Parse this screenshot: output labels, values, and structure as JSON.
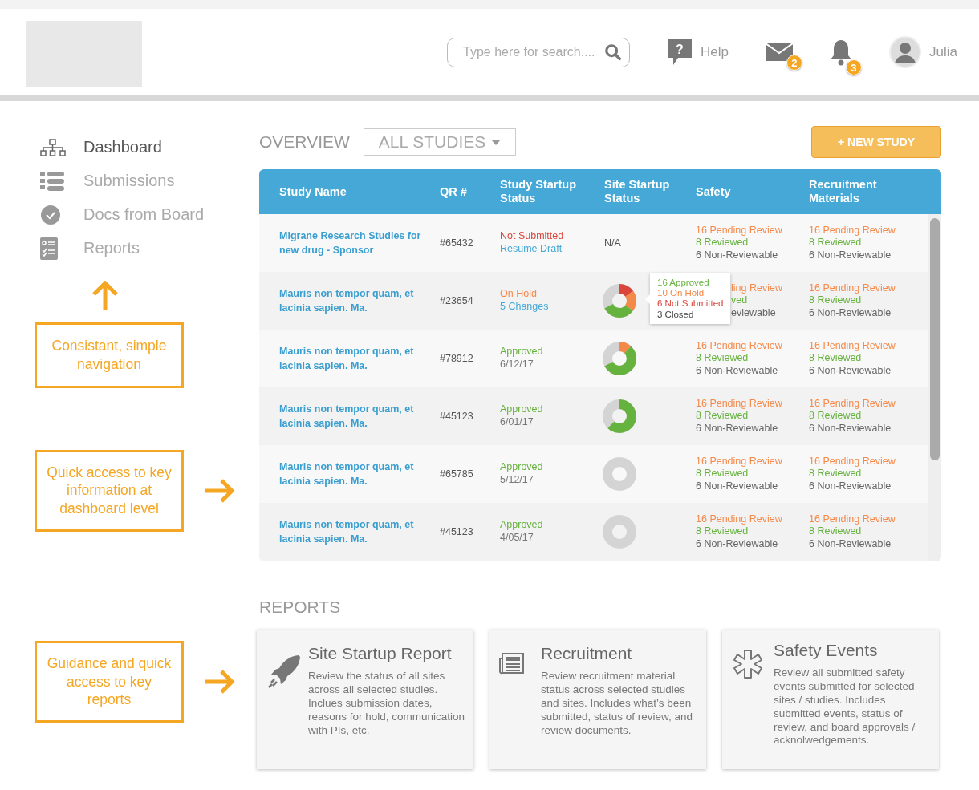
{
  "header": {
    "search": {
      "placeholder": "Type here for search...."
    },
    "help_icon": "?",
    "help": "Help",
    "mail_badge": "2",
    "bell_badge": "3",
    "user": "Julia"
  },
  "nav": [
    {
      "label": "Dashboard",
      "kind": "dashboard",
      "selected": true
    },
    {
      "label": "Submissions",
      "kind": "submissions",
      "selected": false
    },
    {
      "label": "Docs from Board",
      "kind": "docs",
      "selected": false
    },
    {
      "label": "Reports",
      "kind": "reports",
      "selected": false
    }
  ],
  "callouts": [
    {
      "text": "Consistant, simple navigation",
      "kind": "up"
    },
    {
      "text": "Quick access to key information at dashboard level",
      "kind": "right"
    },
    {
      "text": "Guidance and quick access to key reports",
      "kind": "right"
    }
  ],
  "overview": {
    "title": "OVERVIEW",
    "filter": "ALL STUDIES",
    "new_button": "+ NEW STUDY"
  },
  "table": {
    "columns": [
      "Study Name",
      "QR #",
      "Study Startup Status",
      "Site Startup Status",
      "Safety",
      "Recruitment Materials"
    ],
    "rows": [
      {
        "name": "Migrane Research Studies for new drug - Sponsor",
        "qr": "#65432",
        "status": {
          "kind": "not_submitted",
          "state": "Not Submitted",
          "detail": "Resume Draft"
        },
        "site": {
          "kind": "text",
          "text": "N/A"
        },
        "safety": [
          "16 Pending Review",
          "8 Reviewed",
          "6 Non-Reviewable"
        ],
        "recruitment": [
          "16 Pending Review",
          "8 Reviewed",
          "6 Non-Reviewable"
        ]
      },
      {
        "name": "Mauris non tempor quam, et lacinia sapien. Ma.",
        "qr": "#23654",
        "status": {
          "kind": "on_hold",
          "state": "On Hold",
          "detail": "5 Changes"
        },
        "site": {
          "kind": "donut",
          "segments": [
            {
              "color": "#d9453a",
              "level": 0.15
            },
            {
              "color": "#f5894a",
              "level": 0.2
            },
            {
              "color": "#66b23e",
              "level": 0.32
            }
          ],
          "tooltip": [
            {
              "text": "16 Approved",
              "color": "#66b23e"
            },
            {
              "text": "10 On Hold",
              "color": "#f5894a"
            },
            {
              "text": "6 Not Submitted",
              "color": "#d9453a"
            },
            {
              "text": "3 Closed",
              "color": "#444444"
            }
          ]
        },
        "safety": [
          "ling Review",
          "ved",
          "eviewable"
        ],
        "recruitment": [
          "16 Pending Review",
          "8 Reviewed",
          "6 Non-Reviewable"
        ]
      },
      {
        "name": "Mauris non tempor quam, et lacinia sapien. Ma.",
        "qr": "#78912",
        "status": {
          "kind": "approved",
          "state": "Approved",
          "detail": "6/12/17"
        },
        "site": {
          "kind": "donut",
          "segments": [
            {
              "color": "#f5894a",
              "level": 0.12
            },
            {
              "color": "#66b23e",
              "level": 0.55
            }
          ]
        },
        "safety": [
          "16 Pending Review",
          "8 Reviewed",
          "6 Non-Reviewable"
        ],
        "recruitment": [
          "16 Pending Review",
          "8 Reviewed",
          "6 Non-Reviewable"
        ]
      },
      {
        "name": "Mauris non tempor quam, et lacinia sapien. Ma.",
        "qr": "#45123",
        "status": {
          "kind": "approved",
          "state": "Approved",
          "detail": "6/01/17"
        },
        "site": {
          "kind": "donut",
          "segments": [
            {
              "color": "#66b23e",
              "level": 0.62
            }
          ]
        },
        "safety": [
          "16 Pending Review",
          "8 Reviewed",
          "6 Non-Reviewable"
        ],
        "recruitment": [
          "16 Pending Review",
          "8 Reviewed",
          "6 Non-Reviewable"
        ]
      },
      {
        "name": "Mauris non tempor quam, et lacinia sapien. Ma.",
        "qr": "#65785",
        "status": {
          "kind": "approved",
          "state": "Approved",
          "detail": "5/12/17"
        },
        "site": {
          "kind": "donut"
        },
        "safety": [
          "16 Pending Review",
          "8 Reviewed",
          "6 Non-Reviewable"
        ],
        "recruitment": [
          "16 Pending Review",
          "8 Reviewed",
          "6 Non-Reviewable"
        ]
      },
      {
        "name": "Mauris non tempor quam, et lacinia sapien. Ma.",
        "qr": "#45123",
        "status": {
          "kind": "approved",
          "state": "Approved",
          "detail": "4/05/17"
        },
        "site": {
          "kind": "donut"
        },
        "safety": [
          "16 Pending Review",
          "8 Reviewed",
          "6 Non-Reviewable"
        ],
        "recruitment": [
          "16 Pending Review",
          "8 Reviewed",
          "6 Non-Reviewable"
        ]
      }
    ]
  },
  "reports": {
    "title": "REPORTS",
    "cards": [
      {
        "kind": "startup",
        "title": "Site Startup Report",
        "text": "Review the status of all sites across all selected studies. Inclues submission dates, reasons for hold, communication with PIs, etc."
      },
      {
        "kind": "recruitment",
        "title": "Recruitment",
        "text": "Review recruitment material status across selected studies and sites. Includes what’s been submitted, status of review, and review documents."
      },
      {
        "kind": "safety",
        "title": "Safety Events",
        "text": "Review all submitted safety events submitted for selected sites / studies. Includes submitted events, status of review, and board approvals / acknolwedgements."
      }
    ]
  }
}
